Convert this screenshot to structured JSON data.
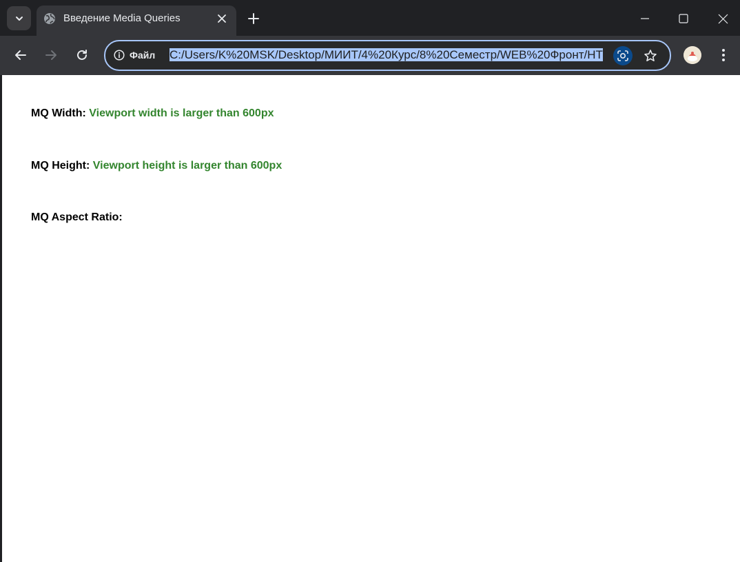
{
  "browser": {
    "tab": {
      "title": "Введение Media Queries"
    },
    "omnibox": {
      "site_info_label": "Файл",
      "url": "C:/Users/K%20MSK/Desktop/МИИТ/4%20Курс/8%20Семестр/WEB%20Фронт/HT"
    },
    "colors": {
      "frame": "#202124",
      "toolbar": "#35363a",
      "omnibox_border": "#a8c7fa",
      "url_highlight": "#a8c7fa"
    },
    "icons": {
      "tab_search": "chevron-down-icon",
      "favicon": "globe-icon",
      "tab_close": "close-icon",
      "new_tab": "plus-icon",
      "minimize": "minimize-icon",
      "maximize": "maximize-icon",
      "window_close": "close-icon",
      "back": "arrow-left-icon",
      "forward": "arrow-right-icon",
      "reload": "reload-icon",
      "site_info": "info-icon",
      "lens": "google-lens-icon",
      "bookmark": "star-icon",
      "profile": "avatar-icon",
      "menu": "kebab-menu-icon"
    }
  },
  "page": {
    "lines": [
      {
        "label": "MQ Width:",
        "value": "Viewport width is larger than 600px"
      },
      {
        "label": "MQ Height:",
        "value": "Viewport height is larger than 600px"
      },
      {
        "label": "MQ Aspect Ratio:",
        "value": ""
      }
    ],
    "colors": {
      "label": "#000000",
      "value": "#33852e",
      "background": "#ffffff"
    }
  }
}
